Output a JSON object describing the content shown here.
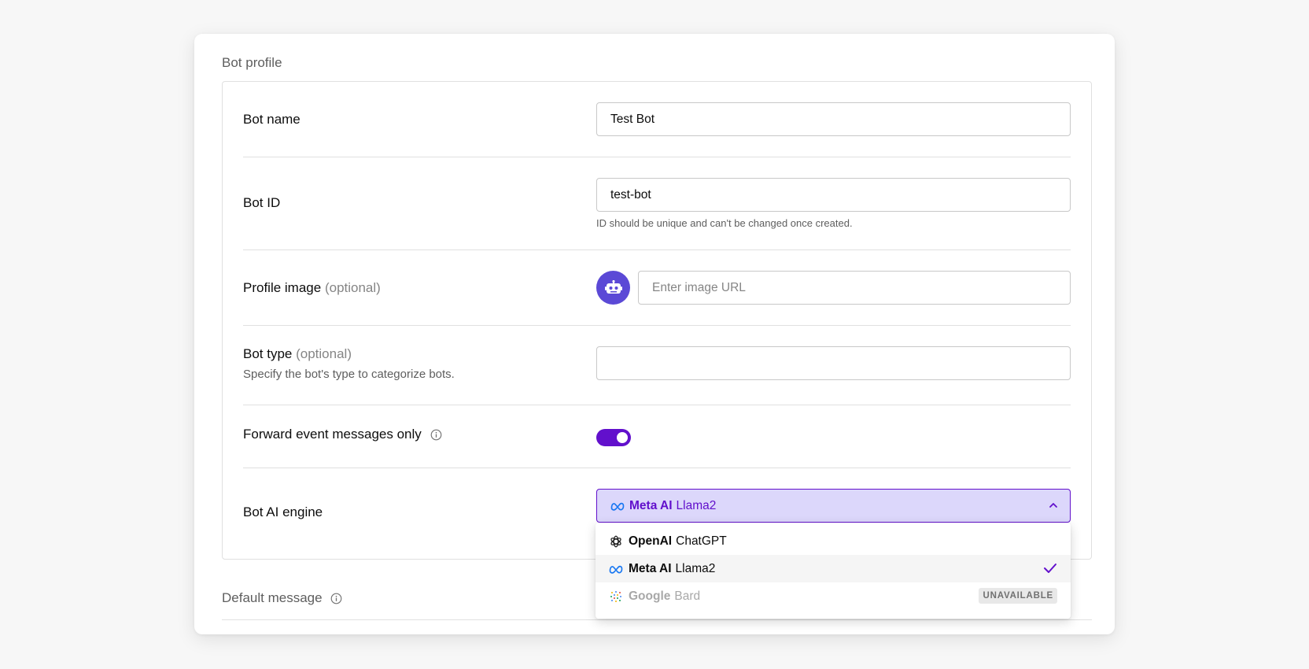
{
  "section": {
    "title": "Bot profile"
  },
  "fields": {
    "bot_name": {
      "label": "Bot name",
      "value": "Test Bot"
    },
    "bot_id": {
      "label": "Bot ID",
      "value": "test-bot",
      "hint": "ID should be unique and can't be changed once created."
    },
    "profile_image": {
      "label": "Profile image",
      "optional": "(optional)",
      "placeholder": "Enter image URL",
      "avatar_icon": "robot-icon"
    },
    "bot_type": {
      "label": "Bot type",
      "optional": "(optional)",
      "description": "Specify the bot's type to categorize bots.",
      "value": ""
    },
    "forward_events": {
      "label": "Forward event messages only",
      "enabled": true
    },
    "ai_engine": {
      "label": "Bot AI engine",
      "selected": {
        "provider": "Meta AI",
        "model": "Llama2"
      },
      "options": [
        {
          "provider": "OpenAI",
          "model": "ChatGPT",
          "icon": "openai-icon"
        },
        {
          "provider": "Meta AI",
          "model": "Llama2",
          "icon": "meta-icon",
          "selected": true
        },
        {
          "provider": "Google",
          "model": "Bard",
          "icon": "google-bard-icon",
          "badge": "UNAVAILABLE"
        }
      ]
    }
  },
  "default_message": {
    "title": "Default message"
  },
  "colors": {
    "accent": "#6210cc",
    "avatar_bg": "#5b49d6",
    "select_bg": "#dcd7fb"
  }
}
